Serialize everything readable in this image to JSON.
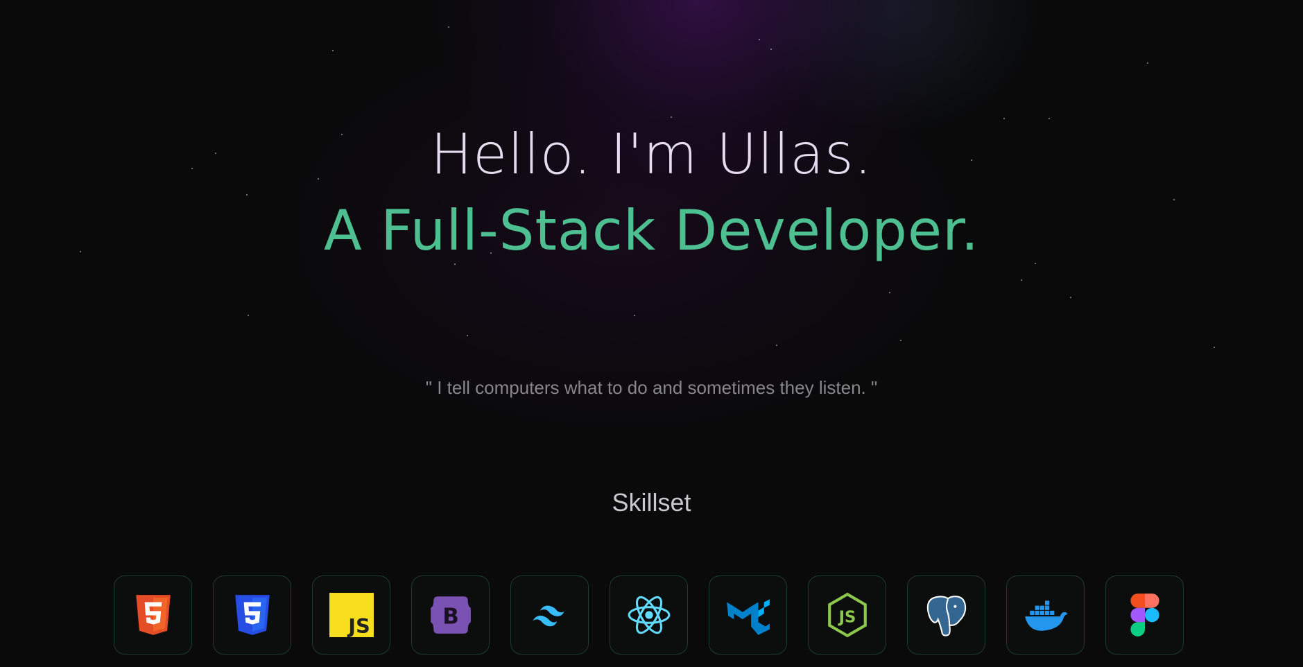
{
  "hero": {
    "greeting": "Hello. I'm Ullas.",
    "role": "A Full-Stack Developer.",
    "quote": "\" I tell computers what to do and sometimes they listen. \""
  },
  "skillset": {
    "title": "Skillset",
    "items": [
      {
        "icon": "html5-icon",
        "color": "#e44d26"
      },
      {
        "icon": "css3-icon",
        "color": "#264de4"
      },
      {
        "icon": "javascript-icon",
        "color": "#f7df1e"
      },
      {
        "icon": "bootstrap-icon",
        "color": "#7952b3"
      },
      {
        "icon": "tailwind-icon",
        "color": "#38bdf8"
      },
      {
        "icon": "react-icon",
        "color": "#61dafb"
      },
      {
        "icon": "material-ui-icon",
        "color": "#0081cb"
      },
      {
        "icon": "nodejs-icon",
        "color": "#8cc84b"
      },
      {
        "icon": "postgresql-icon",
        "color": "#336791"
      },
      {
        "icon": "docker-icon",
        "color": "#2496ed"
      },
      {
        "icon": "figma-icon",
        "color": "#a259ff"
      }
    ]
  },
  "colors": {
    "background": "#0a0a0b",
    "accent": "#4dbf90",
    "heading": "#e6dcf0"
  }
}
